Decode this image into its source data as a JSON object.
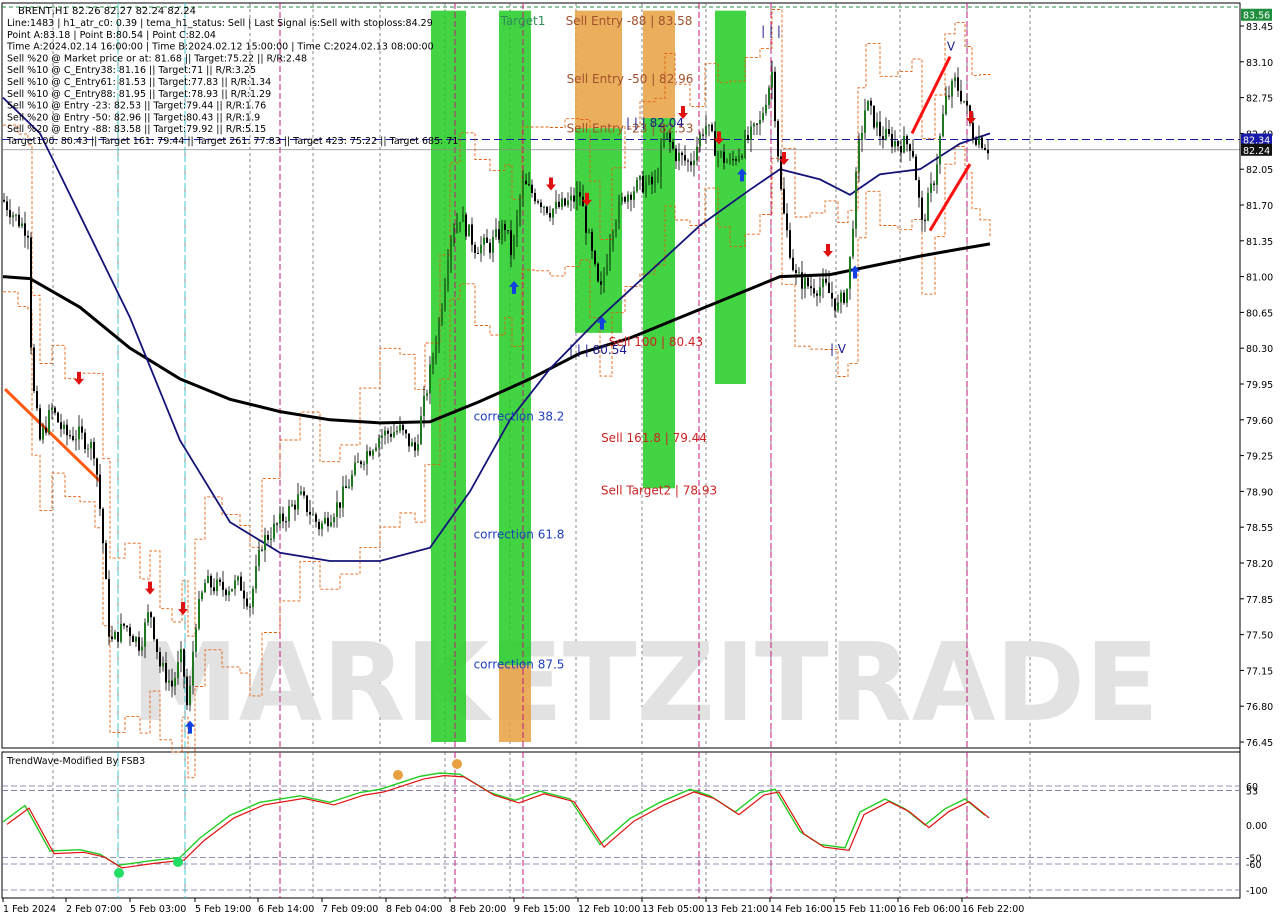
{
  "header": {
    "symbol_line": "BRENT,H1  82.26 82.27 82.24 82.24",
    "info_lines": [
      "Line:1483 | h1_atr_c0: 0.39 | tema_h1_status: Sell | Last Signal is:Sell with stoploss:84.29",
      "Point A:83.18 | Point B:80.54 | Point C:82.04",
      "Time A:2024.02.14 16:00:00 | Time B:2024.02.12 15:00:00 | Time C:2024.02.13 08:00:00",
      "Sell %20 @ Market price or at: 81.68 || Target:75.22 || R/R:2.48",
      "Sell %10 @ C_Entry38: 81.16 || Target:71 || R/R:3.25",
      "Sell %10 @ C_Entry61: 81.53 || Target:77.83 || R/R:1.34",
      "Sell %10 @ C_Entry88: 81.95 || Target:78.93 || R/R:1.29",
      "Sell %10 @ Entry -23: 82.53 || Target:79.44 || R/R:1.76",
      "Sell %20 @ Entry -50: 82.96 || Target:80.43 || R/R:1.9",
      "Sell %20 @ Entry -88: 83.58 || Target:79.92 || R/R:5.15",
      "Target100: 80.43 || Target 161: 79.44 || Target 261: 77.83 || Target 423: 75.22 || Target 685: 71"
    ]
  },
  "watermark": "MARKETZITRADE",
  "chart_labels": [
    {
      "text": "Target1",
      "color": "#2e8b57",
      "x": 523,
      "price": 83.5
    },
    {
      "text": "Sell Entry -88 | 83.58",
      "color": "#a0522d",
      "x": 629,
      "price": 83.5
    },
    {
      "text": "Sell Entry -50 | 82.96",
      "color": "#a0522d",
      "x": 630,
      "price": 82.93
    },
    {
      "text": "Sell Entry -23 | 82.53",
      "color": "#a0522d",
      "x": 630,
      "price": 82.45
    },
    {
      "text": "| | | 82.04",
      "color": "#1a1a8c",
      "x": 655,
      "price": 82.5
    },
    {
      "text": "correction 38.2",
      "color": "#1f3fbf",
      "x": 519,
      "price": 79.63
    },
    {
      "text": "correction 61.8",
      "color": "#1f3fbf",
      "x": 519,
      "price": 78.48
    },
    {
      "text": "correction 87.5",
      "color": "#1f3fbf",
      "x": 519,
      "price": 77.21
    },
    {
      "text": "Sell 100 | 80.43",
      "color": "#cc2222",
      "x": 656,
      "price": 80.36
    },
    {
      "text": "Sell 161.8 | 79.44",
      "color": "#cc2222",
      "x": 654,
      "price": 79.42
    },
    {
      "text": "Sell Target2 | 78.93",
      "color": "#cc2222",
      "x": 659,
      "price": 78.91
    },
    {
      "text": "| | | 80.54",
      "color": "#1a1a8c",
      "x": 598,
      "price": 80.28
    },
    {
      "text": "| | |",
      "color": "#1a1a8c",
      "x": 771,
      "price": 83.4
    },
    {
      "text": "V",
      "color": "#1a1a8c",
      "x": 951,
      "price": 83.25
    },
    {
      "text": "| V",
      "color": "#1a1a8c",
      "x": 838,
      "price": 80.29
    }
  ],
  "price_badges": [
    {
      "text": "83.56",
      "bg": "#1f8f3f",
      "price": 83.56
    },
    {
      "text": "82.34",
      "bg": "#1a1aa8",
      "price": 82.34
    },
    {
      "text": "82.24",
      "bg": "#111111",
      "price": 82.24
    }
  ],
  "indicator": {
    "title": "TrendWave-Modified By FSB3",
    "levels": [
      "60",
      "53",
      "0.00",
      "-50",
      "-60",
      "-100"
    ]
  },
  "chart_data": {
    "type": "candlestick",
    "symbol": "BRENT",
    "timeframe": "H1",
    "y_axis_ticks": [
      "83.56",
      "83.45",
      "83.10",
      "82.75",
      "82.40",
      "82.34",
      "82.24",
      "82.05",
      "81.70",
      "81.35",
      "81.00",
      "80.65",
      "80.30",
      "79.95",
      "79.60",
      "79.25",
      "78.90",
      "78.55",
      "78.20",
      "77.85",
      "77.50",
      "77.15",
      "76.80",
      "76.45"
    ],
    "x_axis_ticks": [
      "1 Feb 2024",
      "2 Feb 07:00",
      "5 Feb 03:00",
      "5 Feb 19:00",
      "6 Feb 14:00",
      "7 Feb 09:00",
      "8 Feb 04:00",
      "8 Feb 20:00",
      "9 Feb 15:00",
      "12 Feb 10:00",
      "13 Feb 05:00",
      "13 Feb 21:00",
      "14 Feb 16:00",
      "15 Feb 11:00",
      "16 Feb 06:00",
      "16 Feb 22:00"
    ],
    "ylim": [
      76.35,
      83.6
    ],
    "path_points": [
      {
        "x": 3,
        "p": 81.75
      },
      {
        "x": 18,
        "p": 81.55
      },
      {
        "x": 28,
        "p": 81.45
      },
      {
        "x": 32,
        "p": 80.0
      },
      {
        "x": 40,
        "p": 79.4
      },
      {
        "x": 52,
        "p": 79.7
      },
      {
        "x": 65,
        "p": 79.45
      },
      {
        "x": 80,
        "p": 79.45
      },
      {
        "x": 95,
        "p": 79.3
      },
      {
        "x": 103,
        "p": 78.4
      },
      {
        "x": 110,
        "p": 77.4
      },
      {
        "x": 125,
        "p": 77.6
      },
      {
        "x": 140,
        "p": 77.4
      },
      {
        "x": 150,
        "p": 77.75
      },
      {
        "x": 160,
        "p": 77.2
      },
      {
        "x": 172,
        "p": 77.0
      },
      {
        "x": 182,
        "p": 77.3
      },
      {
        "x": 188,
        "p": 76.7
      },
      {
        "x": 195,
        "p": 77.6
      },
      {
        "x": 205,
        "p": 78.0
      },
      {
        "x": 222,
        "p": 77.95
      },
      {
        "x": 240,
        "p": 78.0
      },
      {
        "x": 250,
        "p": 77.8
      },
      {
        "x": 262,
        "p": 78.4
      },
      {
        "x": 280,
        "p": 78.6
      },
      {
        "x": 300,
        "p": 78.85
      },
      {
        "x": 320,
        "p": 78.55
      },
      {
        "x": 340,
        "p": 78.8
      },
      {
        "x": 360,
        "p": 79.2
      },
      {
        "x": 380,
        "p": 79.45
      },
      {
        "x": 400,
        "p": 79.5
      },
      {
        "x": 415,
        "p": 79.3
      },
      {
        "x": 425,
        "p": 79.8
      },
      {
        "x": 440,
        "p": 80.6
      },
      {
        "x": 450,
        "p": 81.4
      },
      {
        "x": 460,
        "p": 81.6
      },
      {
        "x": 475,
        "p": 81.3
      },
      {
        "x": 490,
        "p": 81.3
      },
      {
        "x": 505,
        "p": 81.5
      },
      {
        "x": 512,
        "p": 81.2
      },
      {
        "x": 522,
        "p": 81.9
      },
      {
        "x": 535,
        "p": 81.8
      },
      {
        "x": 550,
        "p": 81.65
      },
      {
        "x": 565,
        "p": 81.7
      },
      {
        "x": 580,
        "p": 81.8
      },
      {
        "x": 590,
        "p": 81.3
      },
      {
        "x": 600,
        "p": 80.8
      },
      {
        "x": 612,
        "p": 81.5
      },
      {
        "x": 625,
        "p": 81.8
      },
      {
        "x": 640,
        "p": 81.9
      },
      {
        "x": 655,
        "p": 81.9
      },
      {
        "x": 665,
        "p": 82.4
      },
      {
        "x": 675,
        "p": 82.2
      },
      {
        "x": 690,
        "p": 82.1
      },
      {
        "x": 705,
        "p": 82.5
      },
      {
        "x": 718,
        "p": 82.2
      },
      {
        "x": 730,
        "p": 82.1
      },
      {
        "x": 745,
        "p": 82.3
      },
      {
        "x": 760,
        "p": 82.5
      },
      {
        "x": 772,
        "p": 83.0
      },
      {
        "x": 782,
        "p": 81.7
      },
      {
        "x": 795,
        "p": 81.0
      },
      {
        "x": 810,
        "p": 80.9
      },
      {
        "x": 825,
        "p": 80.9
      },
      {
        "x": 838,
        "p": 80.7
      },
      {
        "x": 848,
        "p": 80.9
      },
      {
        "x": 858,
        "p": 82.2
      },
      {
        "x": 866,
        "p": 82.7
      },
      {
        "x": 880,
        "p": 82.4
      },
      {
        "x": 898,
        "p": 82.3
      },
      {
        "x": 912,
        "p": 82.3
      },
      {
        "x": 922,
        "p": 81.5
      },
      {
        "x": 935,
        "p": 82.0
      },
      {
        "x": 945,
        "p": 82.7
      },
      {
        "x": 955,
        "p": 82.9
      },
      {
        "x": 965,
        "p": 82.7
      },
      {
        "x": 972,
        "p": 82.4
      },
      {
        "x": 980,
        "p": 82.35
      },
      {
        "x": 990,
        "p": 82.24
      }
    ],
    "ma_slow": [
      {
        "x": 3,
        "p": 81.0
      },
      {
        "x": 30,
        "p": 80.98
      },
      {
        "x": 80,
        "p": 80.7
      },
      {
        "x": 130,
        "p": 80.3
      },
      {
        "x": 180,
        "p": 80.0
      },
      {
        "x": 230,
        "p": 79.8
      },
      {
        "x": 280,
        "p": 79.68
      },
      {
        "x": 330,
        "p": 79.6
      },
      {
        "x": 380,
        "p": 79.57
      },
      {
        "x": 430,
        "p": 79.58
      },
      {
        "x": 480,
        "p": 79.78
      },
      {
        "x": 530,
        "p": 80.0
      },
      {
        "x": 580,
        "p": 80.25
      },
      {
        "x": 630,
        "p": 80.4
      },
      {
        "x": 680,
        "p": 80.6
      },
      {
        "x": 730,
        "p": 80.8
      },
      {
        "x": 780,
        "p": 81.0
      },
      {
        "x": 830,
        "p": 81.02
      },
      {
        "x": 870,
        "p": 81.1
      },
      {
        "x": 920,
        "p": 81.2
      },
      {
        "x": 960,
        "p": 81.27
      },
      {
        "x": 990,
        "p": 81.32
      }
    ],
    "ma_fast": [
      {
        "x": 3,
        "p": 82.75
      },
      {
        "x": 40,
        "p": 82.4
      },
      {
        "x": 90,
        "p": 81.4
      },
      {
        "x": 130,
        "p": 80.6
      },
      {
        "x": 180,
        "p": 79.4
      },
      {
        "x": 230,
        "p": 78.6
      },
      {
        "x": 280,
        "p": 78.3
      },
      {
        "x": 330,
        "p": 78.22
      },
      {
        "x": 380,
        "p": 78.22
      },
      {
        "x": 430,
        "p": 78.35
      },
      {
        "x": 470,
        "p": 78.9
      },
      {
        "x": 510,
        "p": 79.6
      },
      {
        "x": 550,
        "p": 80.1
      },
      {
        "x": 600,
        "p": 80.6
      },
      {
        "x": 650,
        "p": 81.05
      },
      {
        "x": 700,
        "p": 81.5
      },
      {
        "x": 750,
        "p": 81.85
      },
      {
        "x": 780,
        "p": 82.05
      },
      {
        "x": 820,
        "p": 81.95
      },
      {
        "x": 850,
        "p": 81.8
      },
      {
        "x": 880,
        "p": 82.0
      },
      {
        "x": 920,
        "p": 82.05
      },
      {
        "x": 960,
        "p": 82.3
      },
      {
        "x": 990,
        "p": 82.4
      }
    ],
    "zones": [
      {
        "x1": 431,
        "x2": 466,
        "p_top": 83.6,
        "p_bot": 76.45,
        "color": "#22cc22"
      },
      {
        "x1": 499,
        "x2": 531,
        "p_top": 83.6,
        "p_bot": 77.2,
        "color": "#22cc22"
      },
      {
        "x1": 499,
        "x2": 531,
        "p_top": 77.2,
        "p_bot": 76.45,
        "color": "#e8a040"
      },
      {
        "x1": 575,
        "x2": 622,
        "p_top": 83.6,
        "p_bot": 82.45,
        "color": "#e8a040"
      },
      {
        "x1": 575,
        "x2": 622,
        "p_top": 82.45,
        "p_bot": 80.45,
        "color": "#22cc22"
      },
      {
        "x1": 643,
        "x2": 675,
        "p_top": 83.6,
        "p_bot": 82.55,
        "color": "#e8a040"
      },
      {
        "x1": 643,
        "x2": 675,
        "p_top": 82.55,
        "p_bot": 78.93,
        "color": "#22cc22"
      },
      {
        "x1": 715,
        "x2": 746,
        "p_top": 83.6,
        "p_bot": 79.95,
        "color": "#22cc22"
      }
    ],
    "sell_arrows": [
      {
        "x": 79,
        "price": 80.0
      },
      {
        "x": 150,
        "price": 77.95
      },
      {
        "x": 183,
        "price": 77.75
      },
      {
        "x": 551,
        "price": 81.9
      },
      {
        "x": 587,
        "price": 81.75
      },
      {
        "x": 683,
        "price": 82.6
      },
      {
        "x": 719,
        "price": 82.35
      },
      {
        "x": 784,
        "price": 82.15
      },
      {
        "x": 828,
        "price": 81.25
      },
      {
        "x": 971,
        "price": 82.55
      }
    ],
    "buy_arrows": [
      {
        "x": 190,
        "price": 76.6
      },
      {
        "x": 514,
        "price": 80.9
      },
      {
        "x": 602,
        "price": 80.55
      },
      {
        "x": 742,
        "price": 82.0
      },
      {
        "x": 855,
        "price": 81.05
      }
    ],
    "stop_dashed_price": 82.34,
    "pitch_lines": [
      {
        "x1": 912,
        "p1": 82.4,
        "x2": 950,
        "p2": 83.15
      },
      {
        "x1": 930,
        "p1": 81.45,
        "x2": 970,
        "p2": 82.1
      },
      {
        "x1": 5,
        "p1": 79.9,
        "x2": 100,
        "p2": 79.0
      }
    ],
    "vlines_magenta": [
      280,
      455,
      523,
      699,
      771,
      967
    ],
    "vlines_cyan": [
      118,
      185
    ]
  }
}
